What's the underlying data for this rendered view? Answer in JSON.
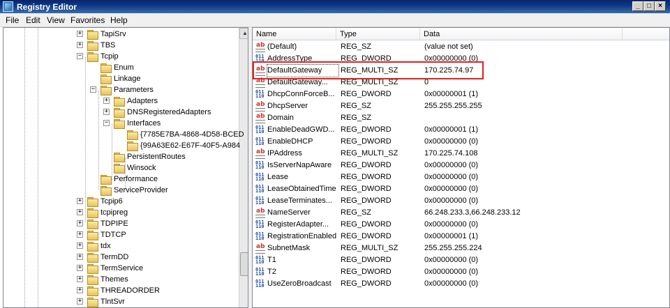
{
  "window": {
    "title": "Registry Editor",
    "minimize": "_",
    "maximize": "□",
    "close": "×"
  },
  "menu": [
    "File",
    "Edit",
    "View",
    "Favorites",
    "Help"
  ],
  "tree": [
    {
      "label": "TapiSrv",
      "level": 0,
      "expander": "+"
    },
    {
      "label": "TBS",
      "level": 0,
      "expander": "+"
    },
    {
      "label": "Tcpip",
      "level": 0,
      "expander": "−"
    },
    {
      "label": "Enum",
      "level": 1,
      "expander": ""
    },
    {
      "label": "Linkage",
      "level": 1,
      "expander": ""
    },
    {
      "label": "Parameters",
      "level": 1,
      "expander": "−"
    },
    {
      "label": "Adapters",
      "level": 2,
      "expander": "+"
    },
    {
      "label": "DNSRegisteredAdapters",
      "level": 2,
      "expander": "+"
    },
    {
      "label": "Interfaces",
      "level": 2,
      "expander": "−"
    },
    {
      "label": "{7785E7BA-4868-4D58-BCED",
      "level": 3,
      "expander": ""
    },
    {
      "label": "{99A63E62-E67F-40F5-A984",
      "level": 3,
      "expander": ""
    },
    {
      "label": "PersistentRoutes",
      "level": 2,
      "expander": ""
    },
    {
      "label": "Winsock",
      "level": 2,
      "expander": ""
    },
    {
      "label": "Performance",
      "level": 1,
      "expander": ""
    },
    {
      "label": "ServiceProvider",
      "level": 1,
      "expander": ""
    },
    {
      "label": "Tcpip6",
      "level": 0,
      "expander": "+"
    },
    {
      "label": "tcpipreg",
      "level": 0,
      "expander": "+"
    },
    {
      "label": "TDPIPE",
      "level": 0,
      "expander": "+"
    },
    {
      "label": "TDTCP",
      "level": 0,
      "expander": "+"
    },
    {
      "label": "tdx",
      "level": 0,
      "expander": "+"
    },
    {
      "label": "TermDD",
      "level": 0,
      "expander": "+"
    },
    {
      "label": "TermService",
      "level": 0,
      "expander": "+"
    },
    {
      "label": "Themes",
      "level": 0,
      "expander": "+"
    },
    {
      "label": "THREADORDER",
      "level": 0,
      "expander": "+"
    },
    {
      "label": "TlntSvr",
      "level": 0,
      "expander": "+"
    }
  ],
  "columns": {
    "name": "Name",
    "type": "Type",
    "data": "Data"
  },
  "values": [
    {
      "icon": "sz",
      "name": "(Default)",
      "type": "REG_SZ",
      "data": "(value not set)"
    },
    {
      "icon": "dw",
      "name": "AddressType",
      "type": "REG_DWORD",
      "data": "0x00000000 (0)"
    },
    {
      "icon": "sz",
      "name": "DefaultGateway",
      "type": "REG_MULTI_SZ",
      "data": "170.225.74.97"
    },
    {
      "icon": "sz",
      "name": "DefaultGateway...",
      "type": "REG_MULTI_SZ",
      "data": "0"
    },
    {
      "icon": "dw",
      "name": "DhcpConnForceB...",
      "type": "REG_DWORD",
      "data": "0x00000001 (1)"
    },
    {
      "icon": "sz",
      "name": "DhcpServer",
      "type": "REG_SZ",
      "data": "255.255.255.255"
    },
    {
      "icon": "sz",
      "name": "Domain",
      "type": "REG_SZ",
      "data": ""
    },
    {
      "icon": "dw",
      "name": "EnableDeadGWD...",
      "type": "REG_DWORD",
      "data": "0x00000001 (1)"
    },
    {
      "icon": "dw",
      "name": "EnableDHCP",
      "type": "REG_DWORD",
      "data": "0x00000000 (0)"
    },
    {
      "icon": "sz",
      "name": "IPAddress",
      "type": "REG_MULTI_SZ",
      "data": "170.225.74.108"
    },
    {
      "icon": "dw",
      "name": "IsServerNapAware",
      "type": "REG_DWORD",
      "data": "0x00000000 (0)"
    },
    {
      "icon": "dw",
      "name": "Lease",
      "type": "REG_DWORD",
      "data": "0x00000000 (0)"
    },
    {
      "icon": "dw",
      "name": "LeaseObtainedTime",
      "type": "REG_DWORD",
      "data": "0x00000000 (0)"
    },
    {
      "icon": "dw",
      "name": "LeaseTerminates...",
      "type": "REG_DWORD",
      "data": "0x00000000 (0)"
    },
    {
      "icon": "sz",
      "name": "NameServer",
      "type": "REG_SZ",
      "data": "66.248.233.3,66.248.233.12"
    },
    {
      "icon": "dw",
      "name": "RegisterAdapter...",
      "type": "REG_DWORD",
      "data": "0x00000000 (0)"
    },
    {
      "icon": "dw",
      "name": "RegistrationEnabled",
      "type": "REG_DWORD",
      "data": "0x00000001 (1)"
    },
    {
      "icon": "sz",
      "name": "SubnetMask",
      "type": "REG_MULTI_SZ",
      "data": "255.255.255.224"
    },
    {
      "icon": "dw",
      "name": "T1",
      "type": "REG_DWORD",
      "data": "0x00000000 (0)"
    },
    {
      "icon": "dw",
      "name": "T2",
      "type": "REG_DWORD",
      "data": "0x00000000 (0)"
    },
    {
      "icon": "dw",
      "name": "UseZeroBroadcast",
      "type": "REG_DWORD",
      "data": "0x00000000 (0)"
    }
  ],
  "selected_value": "DefaultGateway",
  "colors": {
    "highlight": "#e02020",
    "titlebar": "#0a246a"
  }
}
